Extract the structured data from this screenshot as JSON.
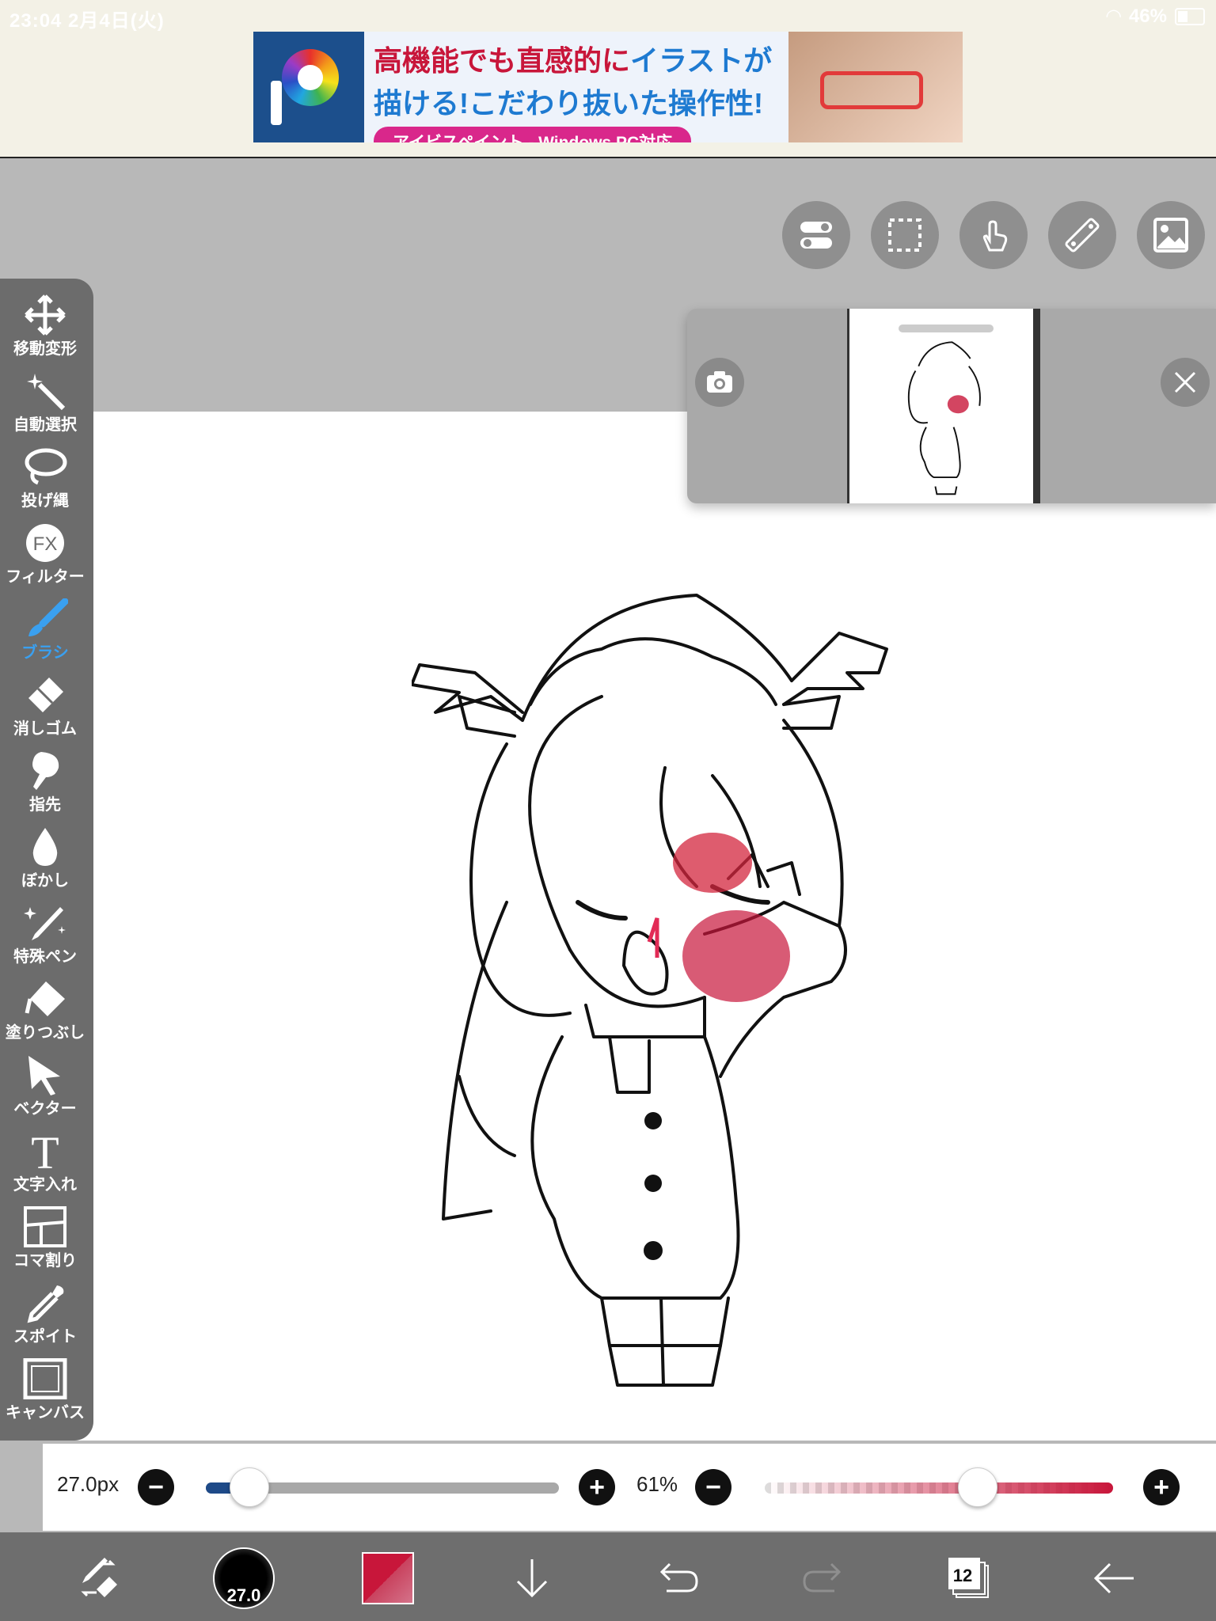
{
  "status_bar": {
    "time_date": "23:04  2月4日(火)",
    "battery": "46%"
  },
  "ad": {
    "line1a": "高機能でも直感的に",
    "line1b": "イラストが",
    "line2": "描ける!こだわり抜いた操作性!",
    "line3": "アイビスペイント - Windows PC対応"
  },
  "left_tools": [
    {
      "label": "移動変形",
      "icon": "move-icon"
    },
    {
      "label": "自動選択",
      "icon": "magic-wand-icon"
    },
    {
      "label": "投げ縄",
      "icon": "lasso-icon"
    },
    {
      "label": "フィルター",
      "icon": "fx-icon"
    },
    {
      "label": "ブラシ",
      "icon": "brush-icon"
    },
    {
      "label": "消しゴム",
      "icon": "eraser-icon"
    },
    {
      "label": "指先",
      "icon": "smudge-icon"
    },
    {
      "label": "ぼかし",
      "icon": "blur-drop-icon"
    },
    {
      "label": "特殊ペン",
      "icon": "special-pen-icon"
    },
    {
      "label": "塗りつぶし",
      "icon": "fill-bucket-icon"
    },
    {
      "label": "ベクター",
      "icon": "vector-arrow-icon"
    },
    {
      "label": "文字入れ",
      "icon": "text-icon"
    },
    {
      "label": "コマ割り",
      "icon": "frame-divider-icon"
    },
    {
      "label": "スポイト",
      "icon": "eyedropper-icon"
    },
    {
      "label": "キャンバス",
      "icon": "canvas-icon"
    }
  ],
  "right_tools": [
    "toggle-icon",
    "selection-icon",
    "gesture-icon",
    "ruler-icon",
    "gallery-icon"
  ],
  "brush": {
    "size_label": "27.0px",
    "size_fraction": 0.12,
    "opacity_label": "61%",
    "opacity_fraction": 0.61,
    "color": "#c8163a"
  },
  "bottom": {
    "brush_preview_label": "27.0",
    "layer_count": "12"
  }
}
